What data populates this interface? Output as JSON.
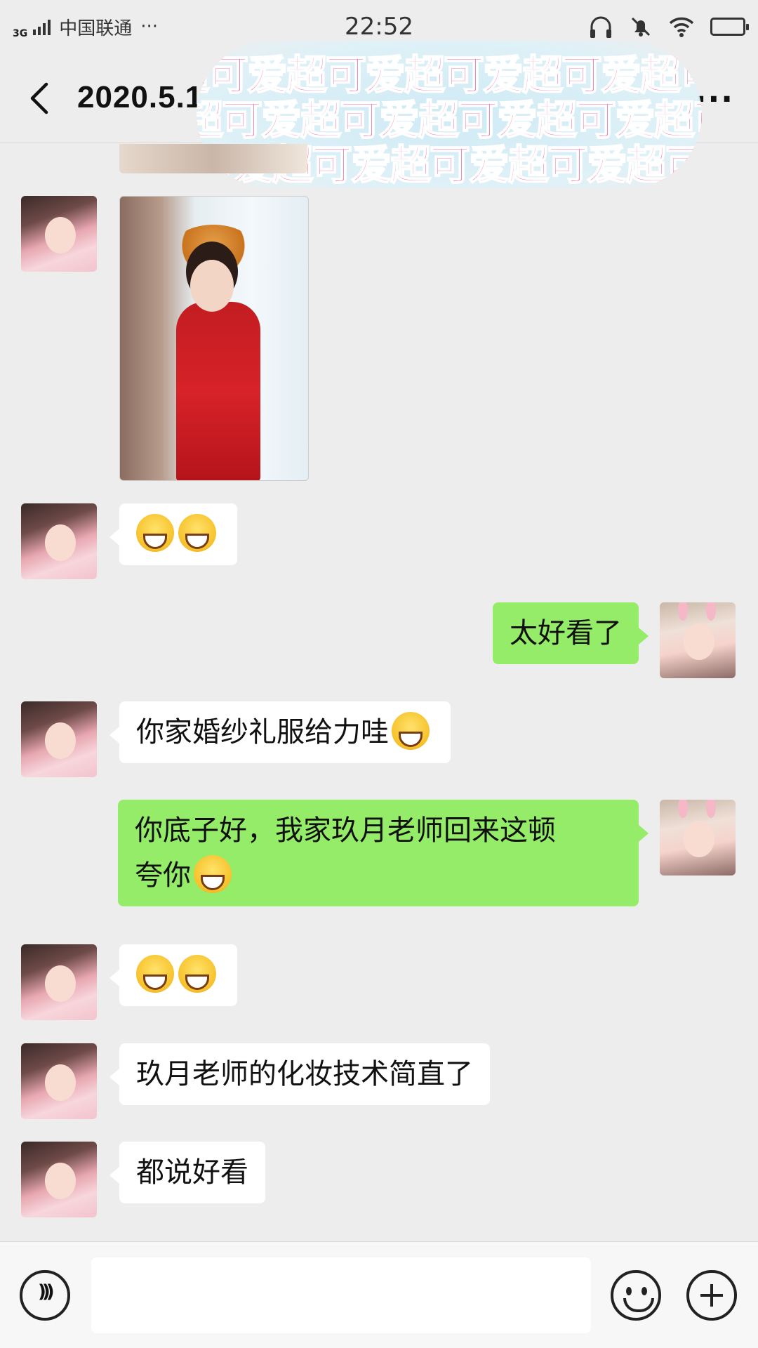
{
  "status_bar": {
    "network": "3G",
    "carrier": "中国联通",
    "dots": "···",
    "time": "22:52"
  },
  "nav": {
    "title": "2020.5.1",
    "more": "···"
  },
  "sticker": {
    "text": "超可爱超可爱超可爱超可爱超可爱超可爱"
  },
  "messages": [
    {
      "side": "left",
      "type": "image"
    },
    {
      "side": "left",
      "type": "emoji",
      "emoji": "grinning-face x2"
    },
    {
      "side": "right",
      "type": "text",
      "text": "太好看了"
    },
    {
      "side": "left",
      "type": "text",
      "text": "你家婚纱礼服给力哇"
    },
    {
      "side": "right",
      "type": "text",
      "line1": "你底子好，我家玖月老师回来这顿",
      "line2": "夸你"
    },
    {
      "side": "left",
      "type": "emoji",
      "emoji": "grinning-face x2"
    },
    {
      "side": "left",
      "type": "text",
      "text": "玖月老师的化妆技术简直了"
    },
    {
      "side": "left",
      "type": "text",
      "text": "都说好看"
    }
  ],
  "colors": {
    "background": "#ededed",
    "incoming_bubble": "#ffffff",
    "outgoing_bubble": "#95ec69",
    "sticker_text": "#f24a8a"
  }
}
